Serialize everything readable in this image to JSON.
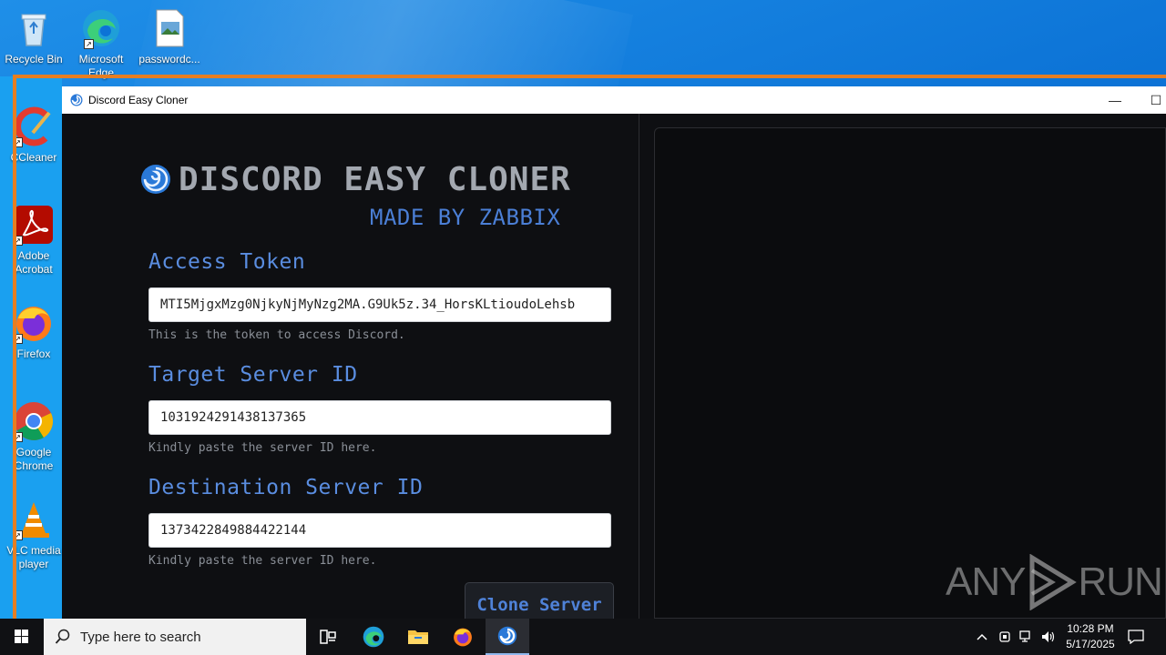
{
  "desktop": {
    "icons": [
      {
        "label": "Recycle Bin"
      },
      {
        "label": "Microsoft Edge"
      },
      {
        "label": "passwordc..."
      },
      {
        "label": "CCleaner"
      },
      {
        "label": "Adobe Acrobat"
      },
      {
        "label": "Firefox"
      },
      {
        "label": "Google Chrome"
      },
      {
        "label": "VLC media player"
      }
    ]
  },
  "window": {
    "title": "Discord Easy Cloner",
    "minimize": "—",
    "maximize": "☐"
  },
  "app": {
    "brand_title": "DISCORD EASY CLONER",
    "brand_sub": "MADE BY ZABBIX",
    "fields": [
      {
        "label": "Access Token",
        "value": "MTI5MjgxMzg0NjkyNjMyNzg2MA.G9Uk5z.34_HorsKLtioudoLehsb",
        "help": "This is the token to access Discord."
      },
      {
        "label": "Target Server ID",
        "value": "1031924291438137365",
        "help": "Kindly paste the server ID here."
      },
      {
        "label": "Destination Server ID",
        "value": "1373422849884422144",
        "help": "Kindly paste the server ID here."
      }
    ],
    "clone_button": "Clone Server"
  },
  "watermark": {
    "left": "ANY",
    "right": "RUN"
  },
  "taskbar": {
    "search_placeholder": "Type here to search",
    "time": "10:28 PM",
    "date": "5/17/2025"
  },
  "colors": {
    "accent": "#5a8de0",
    "desktop_bg": "#0c73d6",
    "orange_frame": "#e67e22",
    "app_bg": "#0e0f12"
  }
}
